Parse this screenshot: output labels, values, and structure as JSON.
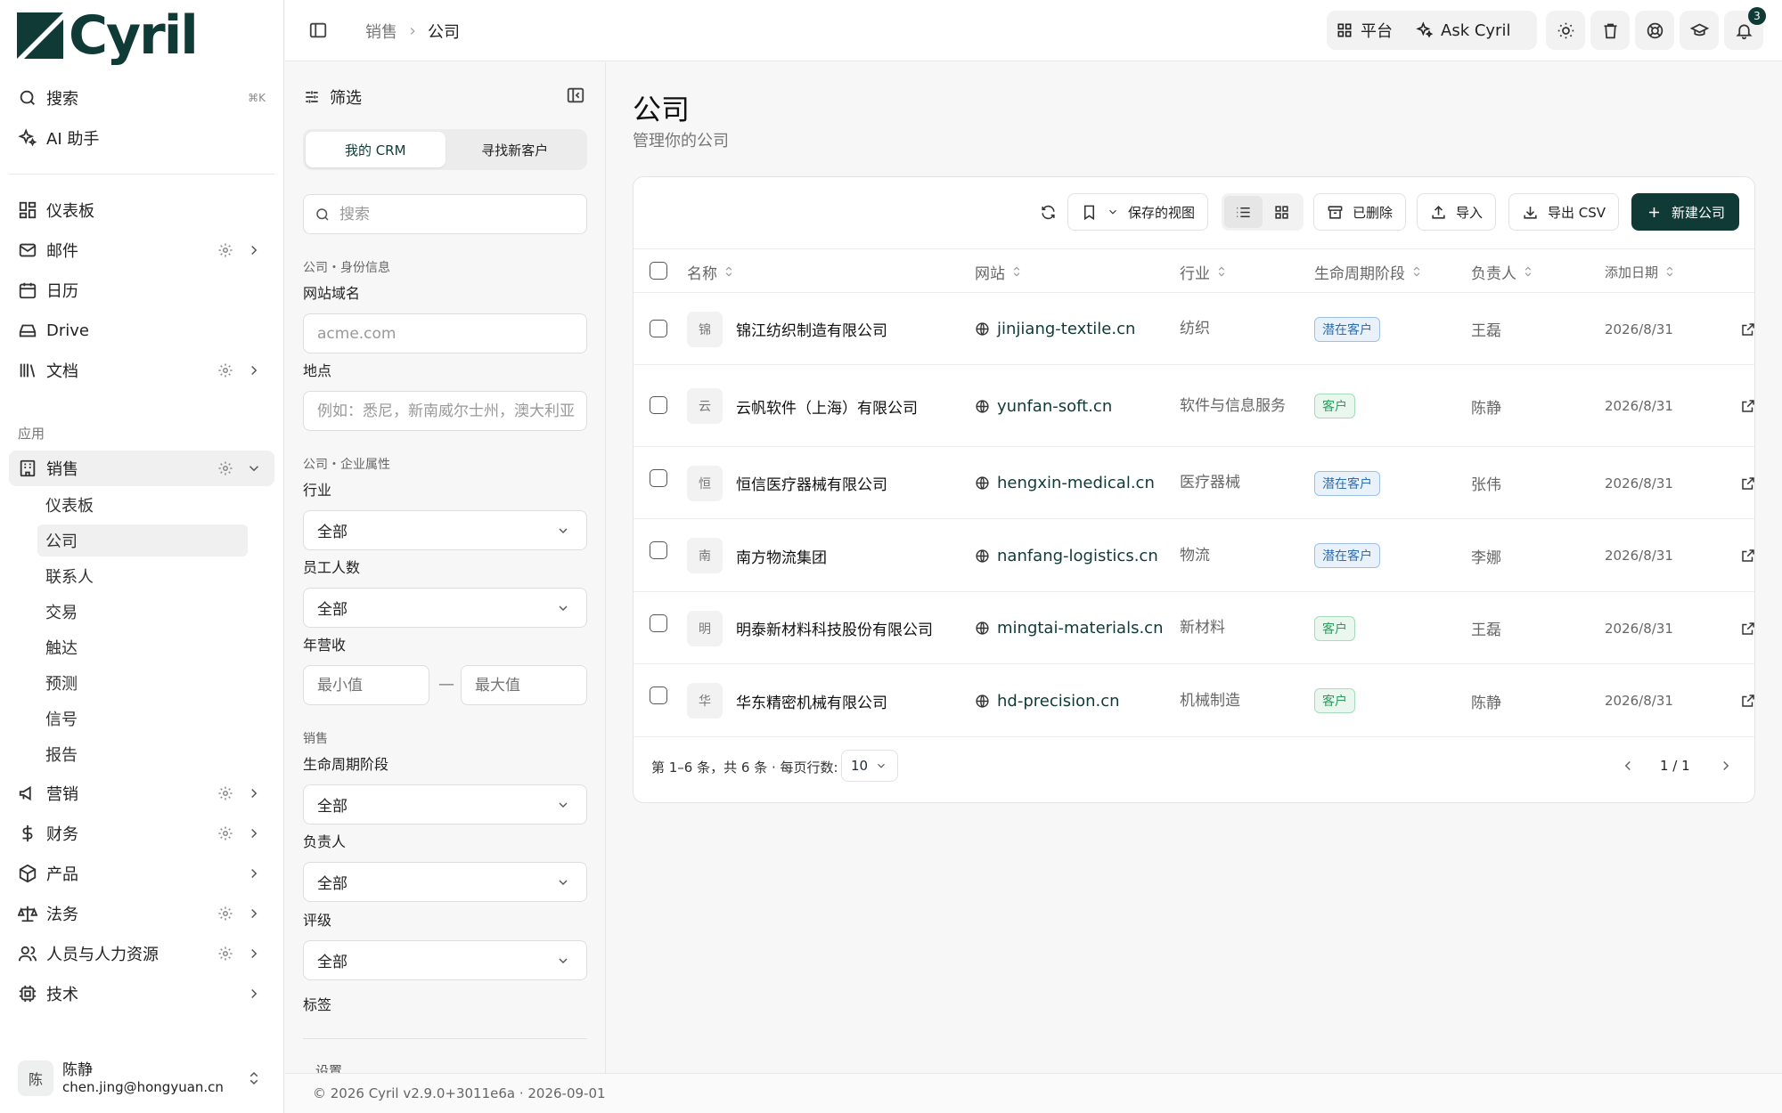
{
  "brand": {
    "name": "Cyril",
    "color": "#0f3a36"
  },
  "nav": {
    "search": {
      "label": "搜索",
      "shortcut": "⌘K"
    },
    "ai": {
      "label": "AI 助手"
    },
    "items": [
      {
        "label": "仪表板",
        "icon": "dashboard-icon"
      },
      {
        "label": "邮件",
        "icon": "mail-icon"
      },
      {
        "label": "日历",
        "icon": "calendar-icon"
      },
      {
        "label": "Drive",
        "icon": "drive-icon"
      },
      {
        "label": "文档",
        "icon": "library-icon"
      }
    ],
    "apps_section": "应用",
    "sales": {
      "label": "销售",
      "sub": [
        "仪表板",
        "公司",
        "联系人",
        "交易",
        "触达",
        "预测",
        "信号",
        "报告"
      ],
      "active_sub": "公司"
    },
    "apps": [
      {
        "label": "营销",
        "icon": "megaphone-icon"
      },
      {
        "label": "财务",
        "icon": "dollar-icon"
      },
      {
        "label": "产品",
        "icon": "package-icon"
      },
      {
        "label": "法务",
        "icon": "scale-icon"
      },
      {
        "label": "人员与人力资源",
        "icon": "users-icon"
      },
      {
        "label": "技术",
        "icon": "cpu-icon"
      }
    ],
    "user": {
      "initial": "陈",
      "name": "陈静",
      "email": "chen.jing@hongyuan.cn"
    }
  },
  "topbar": {
    "breadcrumb": [
      "销售",
      "公司"
    ],
    "platform_label": "平台",
    "ask_label": "Ask Cyril",
    "notification_count": "3"
  },
  "filters": {
    "title": "筛选",
    "tabs": [
      "我的 CRM",
      "寻找新客户"
    ],
    "active_tab": "我的 CRM",
    "search_placeholder": "搜索",
    "identity_section": "公司・身份信息",
    "domain_label": "网站域名",
    "domain_placeholder": "acme.com",
    "location_label": "地点",
    "location_placeholder": "例如：悉尼，新南威尔士州，澳大利亚",
    "attributes_section": "公司・企业属性",
    "industry_label": "行业",
    "industry_value": "全部",
    "employees_label": "员工人数",
    "employees_value": "全部",
    "revenue_label": "年营收",
    "revenue_min_placeholder": "最小值",
    "revenue_max_placeholder": "最大值",
    "range_dash": "—",
    "sales_section": "销售",
    "lifecycle_label": "生命周期阶段",
    "lifecycle_value": "全部",
    "owner_label": "负责人",
    "owner_value": "全部",
    "rating_label": "评级",
    "rating_value": "全部",
    "tags_label": "标签",
    "settings_label": "设置"
  },
  "page": {
    "title": "公司",
    "subtitle": "管理你的公司"
  },
  "toolbar": {
    "saved_views": "保存的视图",
    "deleted": "已删除",
    "import": "导入",
    "export": "导出 CSV",
    "new": "新建公司"
  },
  "table": {
    "columns": [
      "名称",
      "网站",
      "行业",
      "生命周期阶段",
      "负责人",
      "添加日期"
    ],
    "rows": [
      {
        "initial": "锦",
        "name": "锦江纺织制造有限公司",
        "site": "jinjiang-textile.cn",
        "industry": "纺织",
        "stage": "潜在客户",
        "stage_type": "prospect",
        "owner": "王磊",
        "date": "2026/8/31"
      },
      {
        "initial": "云",
        "name": "云帆软件（上海）有限公司",
        "site": "yunfan-soft.cn",
        "industry": "软件与信息服务",
        "stage": "客户",
        "stage_type": "customer",
        "owner": "陈静",
        "date": "2026/8/31"
      },
      {
        "initial": "恒",
        "name": "恒信医疗器械有限公司",
        "site": "hengxin-medical.cn",
        "industry": "医疗器械",
        "stage": "潜在客户",
        "stage_type": "prospect",
        "owner": "张伟",
        "date": "2026/8/31"
      },
      {
        "initial": "南",
        "name": "南方物流集团",
        "site": "nanfang-logistics.cn",
        "industry": "物流",
        "stage": "潜在客户",
        "stage_type": "prospect",
        "owner": "李娜",
        "date": "2026/8/31"
      },
      {
        "initial": "明",
        "name": "明泰新材料科技股份有限公司",
        "site": "mingtai-materials.cn",
        "industry": "新材料",
        "stage": "客户",
        "stage_type": "customer",
        "owner": "王磊",
        "date": "2026/8/31"
      },
      {
        "initial": "华",
        "name": "华东精密机械有限公司",
        "site": "hd-precision.cn",
        "industry": "机械制造",
        "stage": "客户",
        "stage_type": "customer",
        "owner": "陈静",
        "date": "2026/8/31"
      }
    ]
  },
  "pagination": {
    "summary": "第 1–6 条，共 6 条 · 每页行数:",
    "per_page": "10",
    "page": "1 / 1"
  },
  "footer": {
    "version": "© 2026 Cyril v2.9.0+3011e6a · 2026-09-01"
  }
}
